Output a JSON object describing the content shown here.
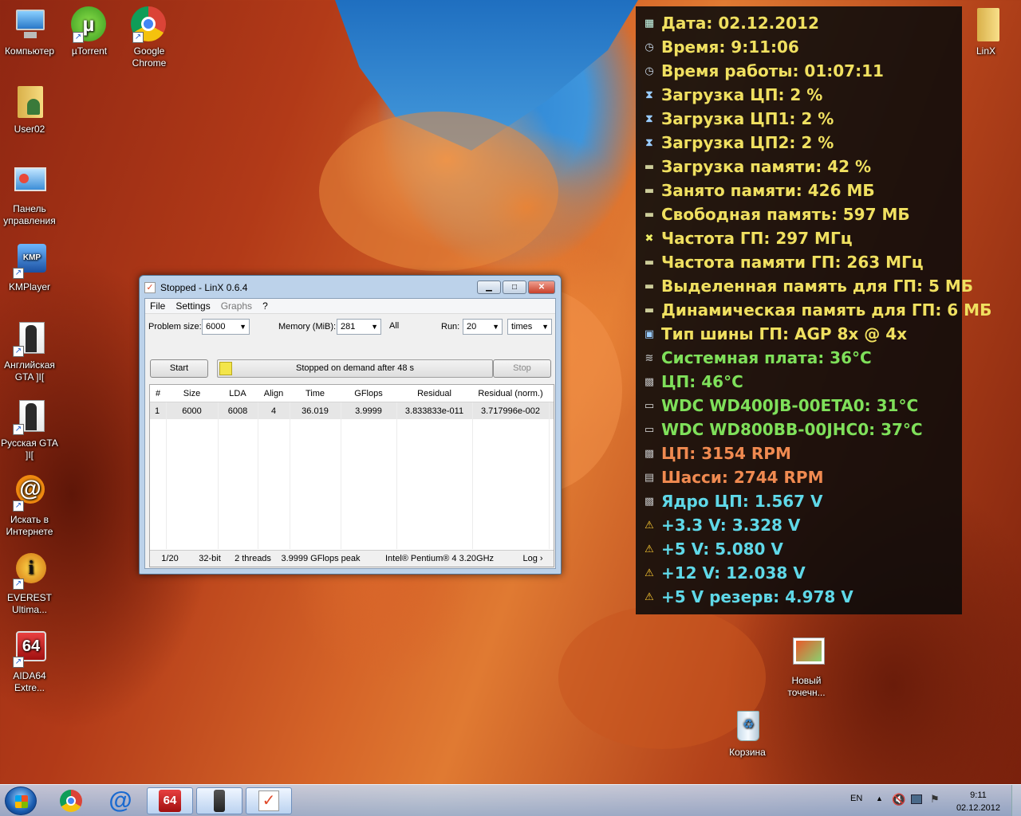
{
  "desktop": {
    "icons": [
      {
        "label": "Компьютер",
        "icon": "computer-icon"
      },
      {
        "label": "µTorrent",
        "icon": "utorrent-icon"
      },
      {
        "label": "Google Chrome",
        "icon": "chrome-icon"
      },
      {
        "label": "User02",
        "icon": "user-folder-icon"
      },
      {
        "label": "Панель управления",
        "icon": "control-panel-icon"
      },
      {
        "label": "KMPlayer",
        "icon": "kmplayer-icon"
      },
      {
        "label": "Английская GTA ]I[",
        "icon": "gta-icon"
      },
      {
        "label": "Русская GTA ]I[",
        "icon": "gta-icon"
      },
      {
        "label": "Искать в Интернете",
        "icon": "search-web-icon"
      },
      {
        "label": "EVEREST Ultima...",
        "icon": "everest-icon"
      },
      {
        "label": "AIDA64 Extre...",
        "icon": "aida64-icon"
      },
      {
        "label": "LinX",
        "icon": "folder-icon"
      },
      {
        "label": "Новый точечн...",
        "icon": "bitmap-file-icon"
      },
      {
        "label": "Корзина",
        "icon": "recycle-bin-icon"
      }
    ]
  },
  "gadget": {
    "rows": [
      {
        "text": "Дата: 02.12.2012",
        "color": "#f0e060",
        "icon": "calendar-icon"
      },
      {
        "text": "Время: 9:11:06",
        "color": "#f0e060",
        "icon": "clock-icon"
      },
      {
        "text": "Время работы: 01:07:11",
        "color": "#f0e060",
        "icon": "clock-icon"
      },
      {
        "text": "Загрузка ЦП: 2 %",
        "color": "#f0e060",
        "icon": "hourglass-icon"
      },
      {
        "text": "Загрузка ЦП1: 2 %",
        "color": "#f0e060",
        "icon": "hourglass-icon"
      },
      {
        "text": "Загрузка ЦП2: 2 %",
        "color": "#f0e060",
        "icon": "hourglass-icon"
      },
      {
        "text": "Загрузка памяти: 42 %",
        "color": "#f0e060",
        "icon": "memory-icon"
      },
      {
        "text": "Занято памяти: 426 МБ",
        "color": "#f0e060",
        "icon": "memory-icon"
      },
      {
        "text": "Свободная память: 597 МБ",
        "color": "#f0e060",
        "icon": "memory-icon"
      },
      {
        "text": "Частота ГП: 297 МГц",
        "color": "#f0e060",
        "icon": "gpu-icon"
      },
      {
        "text": "Частота памяти ГП: 263 МГц",
        "color": "#f0e060",
        "icon": "memory-icon"
      },
      {
        "text": "Выделенная память для ГП: 5 МБ",
        "color": "#f0e060",
        "icon": "memory-icon"
      },
      {
        "text": "Динамическая память для ГП: 6 МБ",
        "color": "#f0e060",
        "icon": "memory-icon"
      },
      {
        "text": "Тип шины ГП: AGP 8x @ 4x",
        "color": "#f0e060",
        "icon": "monitor-icon"
      },
      {
        "text": "Системная плата: 36°C",
        "color": "#7fe05a",
        "icon": "motherboard-icon"
      },
      {
        "text": "ЦП: 46°C",
        "color": "#7fe05a",
        "icon": "cpu-icon"
      },
      {
        "text": "WDC WD400JB-00ETA0: 31°C",
        "color": "#7fe05a",
        "icon": "hdd-icon"
      },
      {
        "text": "WDC WD800BB-00JHC0: 37°C",
        "color": "#7fe05a",
        "icon": "hdd-icon"
      },
      {
        "text": "ЦП: 3154 RPM",
        "color": "#f08a50",
        "icon": "cpu-icon"
      },
      {
        "text": "Шасси: 2744 RPM",
        "color": "#f08a50",
        "icon": "chassis-icon"
      },
      {
        "text": "Ядро ЦП: 1.567 V",
        "color": "#5fd8e8",
        "icon": "cpu-icon"
      },
      {
        "text": "+3.3 V: 3.328 V",
        "color": "#5fd8e8",
        "icon": "warning-icon"
      },
      {
        "text": "+5 V: 5.080 V",
        "color": "#5fd8e8",
        "icon": "warning-icon"
      },
      {
        "text": "+12 V: 12.038 V",
        "color": "#5fd8e8",
        "icon": "warning-icon"
      },
      {
        "text": "+5 V резерв: 4.978 V",
        "color": "#5fd8e8",
        "icon": "warning-icon"
      }
    ]
  },
  "linx": {
    "title": "Stopped - LinX 0.6.4",
    "menu": [
      "File",
      "Settings",
      "Graphs",
      "?"
    ],
    "problem_size_label": "Problem size:",
    "problem_size": "6000",
    "memory_label": "Memory (MiB):",
    "memory": "281",
    "all_label": "All",
    "run_label": "Run:",
    "run": "20",
    "run_unit": "times",
    "start": "Start",
    "stop": "Stop",
    "progress_text": "Stopped on demand after 48 s",
    "columns": [
      "#",
      "Size",
      "LDA",
      "Align",
      "Time",
      "GFlops",
      "Residual",
      "Residual (norm.)"
    ],
    "rows": [
      [
        "1",
        "6000",
        "6008",
        "4",
        "36.019",
        "3.9999",
        "3.833833e-011",
        "3.717996e-002"
      ]
    ],
    "status": [
      "1/20",
      "32-bit",
      "2 threads",
      "3.9999 GFlops peak",
      "Intel® Pentium® 4 3.20GHz",
      "Log ›"
    ]
  },
  "taskbar": {
    "lang": "EN",
    "time": "9:11",
    "date": "02.12.2012"
  }
}
